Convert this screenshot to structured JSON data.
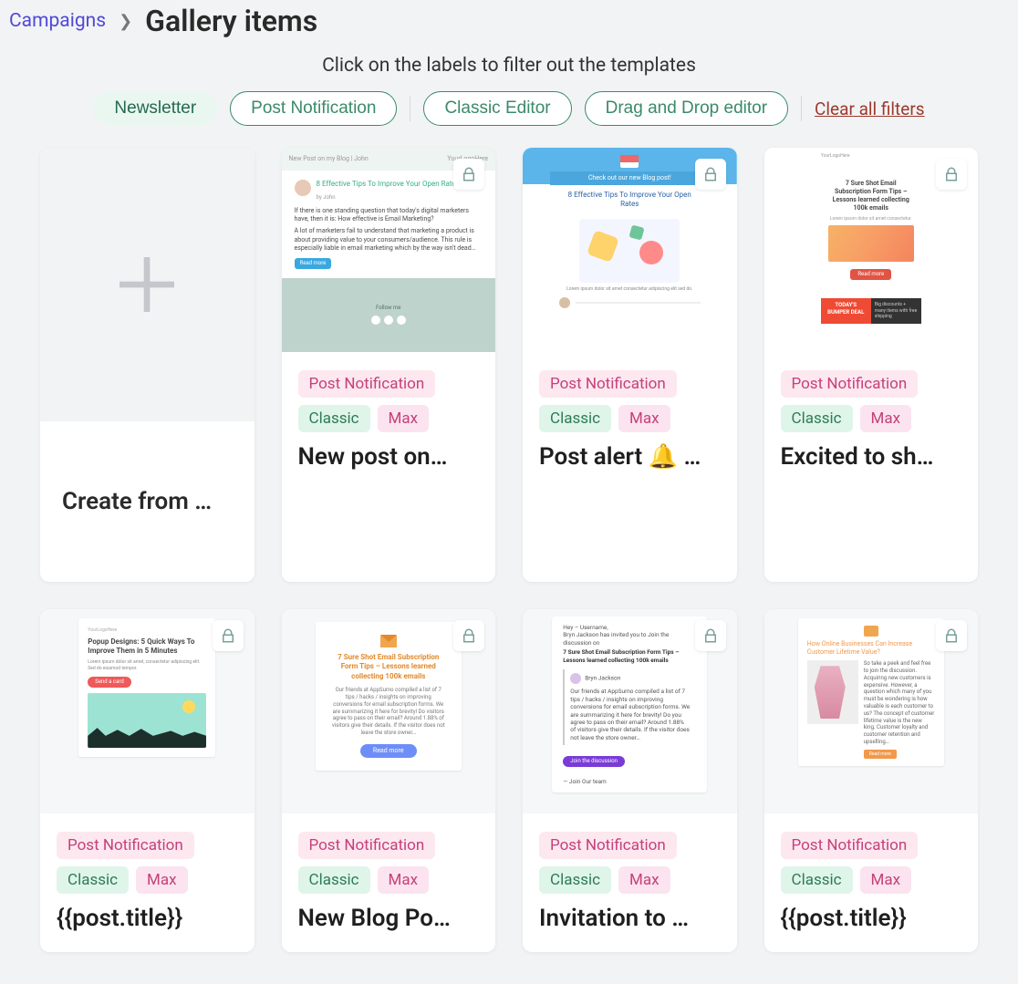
{
  "breadcrumb": {
    "parent": "Campaigns",
    "current": "Gallery items"
  },
  "subtitle": "Click on the labels to filter out the templates",
  "filters": {
    "chips": [
      {
        "label": "Newsletter",
        "active": true
      },
      {
        "label": "Post Notification",
        "active": false
      },
      {
        "label": "Classic Editor",
        "active": false
      },
      {
        "label": "Drag and Drop editor",
        "active": false
      }
    ],
    "clear": "Clear all filters"
  },
  "create_card": {
    "title": "Create from …"
  },
  "tag_labels": {
    "pn": "Post Notification",
    "cl": "Classic",
    "mx": "Max"
  },
  "cards": [
    {
      "title": "New post on…",
      "locked": true
    },
    {
      "title": "Post alert 🔔 …",
      "locked": true
    },
    {
      "title": "Excited to sh…",
      "locked": true
    },
    {
      "title": "{{post.title}}",
      "locked": true
    },
    {
      "title": "New Blog Po…",
      "locked": true
    },
    {
      "title": "Invitation to …",
      "locked": true
    },
    {
      "title": "{{post.title}}",
      "locked": true
    }
  ],
  "thumb_text": {
    "t1": {
      "left": "New Post on my Blog | John",
      "right": "YourLogoHere",
      "headline": "8 Effective Tips To Improve Your Open Rates",
      "by": "by John",
      "p1": "If there is one standing question that today's digital marketers have, then it is: How effective is Email Marketing?",
      "p2": "A lot of marketers fail to understand that marketing a product is about providing value to your consumers/audience. This rule is especially liable in email marketing which by the way isn't dead…",
      "btn": "Read more",
      "follow": "Follow me"
    },
    "t2": {
      "strip": "Check out our new Blog post!",
      "headline": "8 Effective Tips To Improve Your Open Rates"
    },
    "t3": {
      "logo": "YourLogoHere",
      "headline": "7 Sure Shot Email Subscription Form Tips – Lessons learned collecting 100k emails",
      "btn": "Read more",
      "banner1": "TODAY'S BUMPER DEAL",
      "banner2": "Big discounts + many items with free shipping"
    },
    "t4": {
      "logo": "YourLogoHere",
      "headline": "Popup Designs: 5 Quick Ways To Improve Them in 5 Minutes",
      "btn": "Send a card"
    },
    "t5": {
      "headline": "7 Sure Shot Email Subscription Form Tips – Lessons learned collecting 100k emails",
      "p": "Our friends at AppSumo compiled a list of 7 tips / hacks / insights on improving conversions for email subscription forms. We are summarizing it here for brevity! Do visitors agree to pass on their email? Around 1.88% of visitors give their details. If the visitor does not leave the store owner…",
      "btn": "Read more"
    },
    "t6": {
      "greet": "Hey – Username,",
      "line": "Bryn Jackson has invited you to Join the discussion on",
      "headline": "7 Sure Shot Email Subscription Form Tips – Lessons learned collecting 100k emails",
      "author": "Bryn Jackson",
      "body": "Our friends at AppSumo compiled a list of 7 tips / hacks / insights on improving conversions for email subscription forms. We are summarizing it here for brevity! Do you agree to pass on their email? Around 1.88% of visitors give their details. If the visitor does not leave the store owner…",
      "btn": "Join the discussion",
      "sig": "— Join Our team"
    },
    "t7": {
      "headline": "How Online Businesses Can Increase Customer Lifetime Value?",
      "p": "So take a peek and feel free to join the discussion. Acquiring new customers is expensive. However, a question which many of you must be wondering is how valuable is each customer to us? The concept of customer lifetime value is the new king. Customer loyalty and customer retention and upselling…"
    }
  }
}
